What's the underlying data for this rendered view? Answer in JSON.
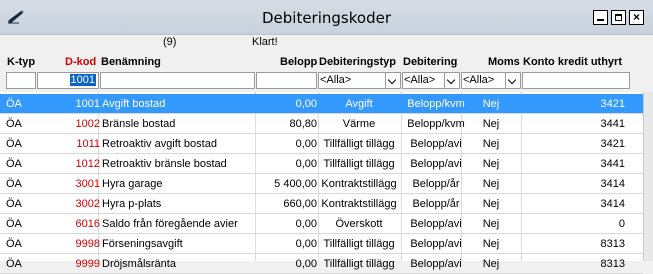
{
  "window": {
    "title": "Debiteringskoder",
    "app_icon": "pencil-icon",
    "buttons": [
      "minimize-icon",
      "maximize-icon",
      "close-icon"
    ],
    "close_glyph": "×"
  },
  "info": {
    "count": "(9)",
    "status": "Klart!"
  },
  "columns": {
    "ktyp": "K-typ",
    "dkod": "D-kod",
    "benamning": "Benämning",
    "belopp": "Belopp",
    "debiteringstyp": "Debiteringstyp",
    "debitering": "Debitering",
    "moms": "Moms",
    "konto": "Konto kredit uthyrt"
  },
  "filters": {
    "ktyp": "",
    "dkod": "1001",
    "benamning": "",
    "belopp": "",
    "debiteringstyp": "<Alla>",
    "debitering": "<Alla>",
    "moms": "<Alla>",
    "konto": ""
  },
  "colors": {
    "selected_row": "#3399ff",
    "dkod_text": "#d40000",
    "title_bar": "#d0d8e2"
  },
  "rows": [
    {
      "ktyp": "ÖA",
      "dkod": "1001",
      "benamning": "Avgift bostad",
      "belopp": "0,00",
      "debiteringstyp": "Avgift",
      "debitering": "Belopp/kvm",
      "moms": "Nej",
      "konto": "3421",
      "selected": true
    },
    {
      "ktyp": "ÖA",
      "dkod": "1002",
      "benamning": "Bränsle bostad",
      "belopp": "80,80",
      "debiteringstyp": "Värme",
      "debitering": "Belopp/kvm",
      "moms": "Nej",
      "konto": "3441",
      "selected": false
    },
    {
      "ktyp": "ÖA",
      "dkod": "1011",
      "benamning": "Retroaktiv avgift bostad",
      "belopp": "0,00",
      "debiteringstyp": "Tillfälligt tillägg",
      "debitering": "Belopp/avi",
      "moms": "Nej",
      "konto": "3421",
      "selected": false
    },
    {
      "ktyp": "ÖA",
      "dkod": "1012",
      "benamning": "Retroaktiv bränsle bostad",
      "belopp": "0,00",
      "debiteringstyp": "Tillfälligt tillägg",
      "debitering": "Belopp/avi",
      "moms": "Nej",
      "konto": "3441",
      "selected": false
    },
    {
      "ktyp": "ÖA",
      "dkod": "3001",
      "benamning": "Hyra garage",
      "belopp": "5 400,00",
      "debiteringstyp": "Kontraktstillägg",
      "debitering": "Belopp/år",
      "moms": "Nej",
      "konto": "3414",
      "selected": false
    },
    {
      "ktyp": "ÖA",
      "dkod": "3002",
      "benamning": "Hyra p-plats",
      "belopp": "660,00",
      "debiteringstyp": "Kontraktstillägg",
      "debitering": "Belopp/år",
      "moms": "Nej",
      "konto": "3414",
      "selected": false
    },
    {
      "ktyp": "ÖA",
      "dkod": "6016",
      "benamning": "Saldo från föregående avier",
      "belopp": "0,00",
      "debiteringstyp": "Överskott",
      "debitering": "Belopp/avi",
      "moms": "Nej",
      "konto": "0",
      "selected": false
    },
    {
      "ktyp": "ÖA",
      "dkod": "9998",
      "benamning": "Förseningsavgift",
      "belopp": "0,00",
      "debiteringstyp": "Tillfälligt tillägg",
      "debitering": "Belopp/avi",
      "moms": "Nej",
      "konto": "8313",
      "selected": false
    },
    {
      "ktyp": "ÖA",
      "dkod": "9999",
      "benamning": "Dröjsmålsränta",
      "belopp": "0,00",
      "debiteringstyp": "Tillfälligt tillägg",
      "debitering": "Belopp/avi",
      "moms": "Nej",
      "konto": "8313",
      "selected": false
    }
  ]
}
